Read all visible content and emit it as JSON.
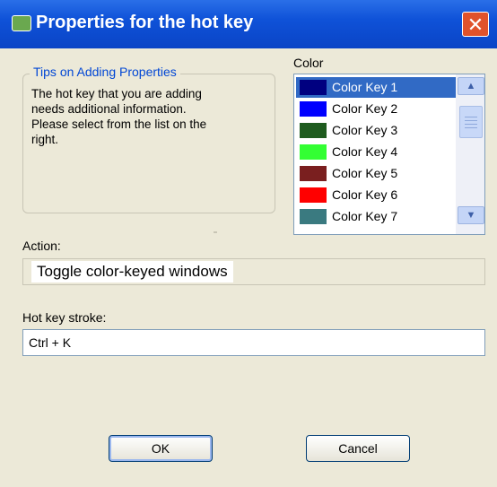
{
  "window": {
    "title": "Properties for the hot key",
    "title_icon": "app-icon",
    "close_icon": "close-icon"
  },
  "tips": {
    "legend": "Tips on Adding Properties",
    "line1": "The hot key that you are adding",
    "line2": "needs additional information.",
    "line3": "Please select from the list on the",
    "line4": "right."
  },
  "color": {
    "label": "Color",
    "selected_index": 0,
    "items": [
      {
        "label": "Color Key 1",
        "swatch": "#000080",
        "selected": true
      },
      {
        "label": "Color Key 2",
        "swatch": "#0000ff"
      },
      {
        "label": "Color Key 3",
        "swatch": "#1e5b1e"
      },
      {
        "label": "Color Key 4",
        "swatch": "#33ff33"
      },
      {
        "label": "Color Key 5",
        "swatch": "#7a1f1f"
      },
      {
        "label": "Color Key 6",
        "swatch": "#ff0000"
      },
      {
        "label": "Color Key 7",
        "swatch": "#3a7a80"
      }
    ]
  },
  "action": {
    "label": "Action:",
    "value": "Toggle color-keyed windows"
  },
  "hotkey": {
    "label": "Hot key stroke:",
    "value": "Ctrl + K"
  },
  "buttons": {
    "ok": "OK",
    "cancel": "Cancel"
  },
  "colors": {
    "titlebar": "#0a44c6",
    "selection": "#316ac5",
    "dialog_bg": "#ece9d8",
    "legend_text": "#0046d5",
    "close_button": "#e0522b"
  }
}
